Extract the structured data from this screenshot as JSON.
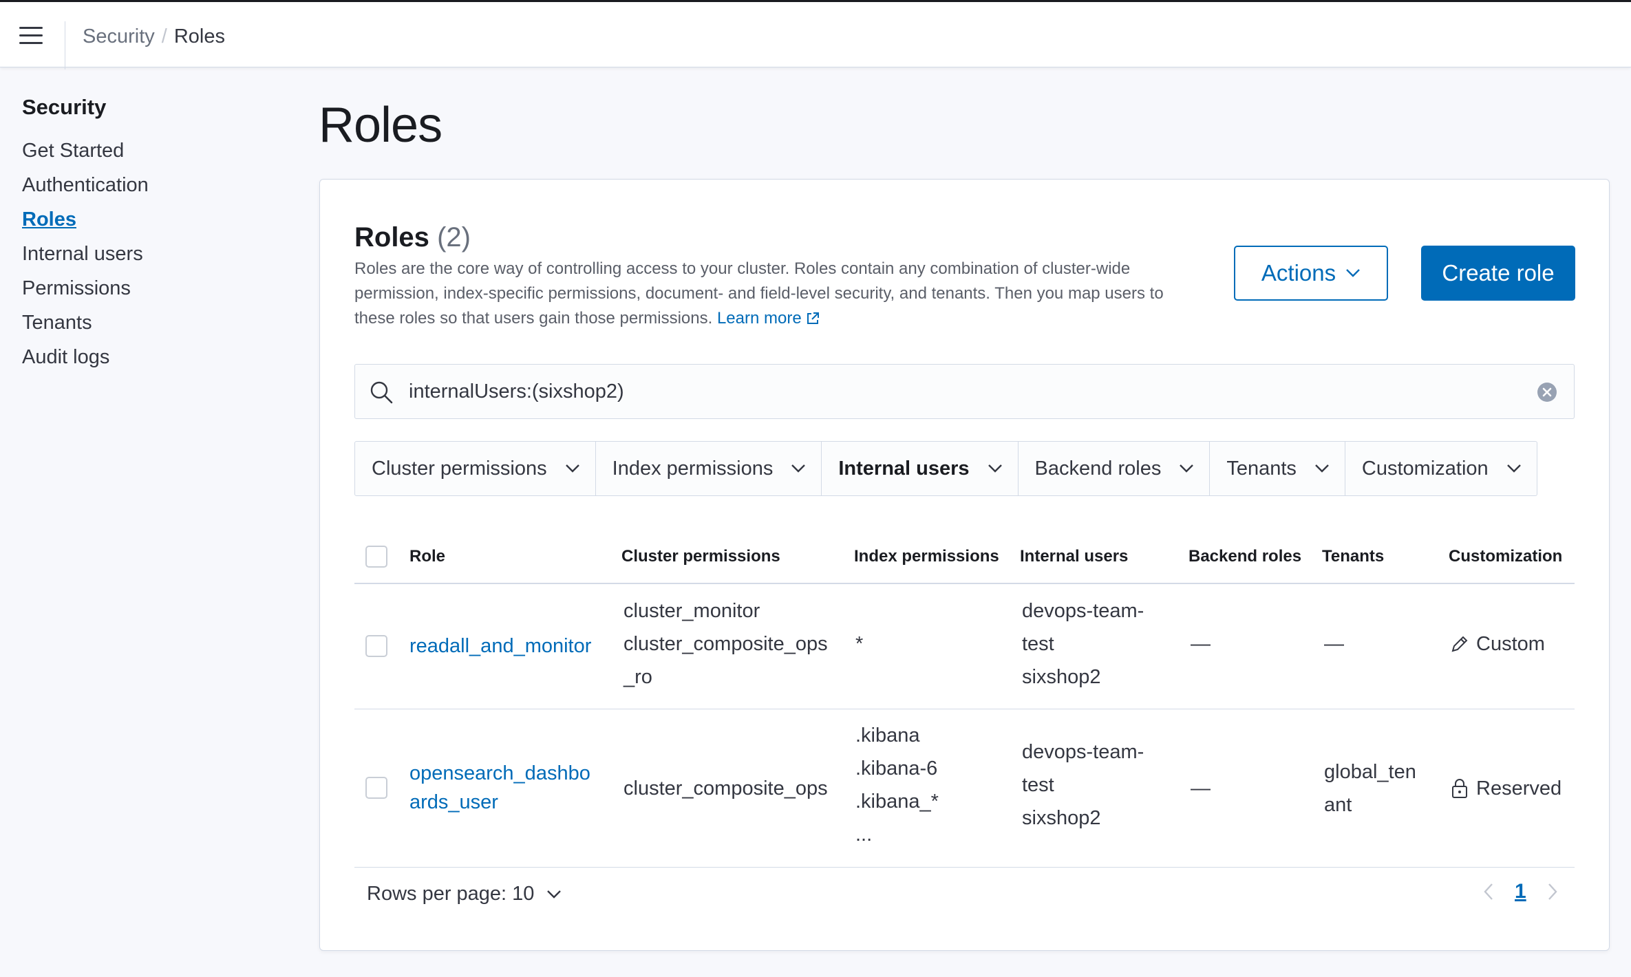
{
  "header": {
    "breadcrumbs": [
      "Security",
      "Roles"
    ]
  },
  "sidebar": {
    "title": "Security",
    "items": [
      {
        "label": "Get Started"
      },
      {
        "label": "Authentication"
      },
      {
        "label": "Roles",
        "active": true
      },
      {
        "label": "Internal users"
      },
      {
        "label": "Permissions"
      },
      {
        "label": "Tenants"
      },
      {
        "label": "Audit logs"
      }
    ]
  },
  "page": {
    "title": "Roles"
  },
  "panel": {
    "title": "Roles",
    "count": "(2)",
    "description": "Roles are the core way of controlling access to your cluster. Roles contain any combination of cluster-wide permission, index-specific permissions, document- and field-level security, and tenants. Then you map users to these roles so that users gain those permissions.",
    "learn_more": "Learn more",
    "actions_label": "Actions",
    "create_label": "Create role"
  },
  "search": {
    "value": "internalUsers:(sixshop2)"
  },
  "filters": [
    {
      "label": "Cluster permissions"
    },
    {
      "label": "Index permissions"
    },
    {
      "label": "Internal users",
      "active": true
    },
    {
      "label": "Backend roles"
    },
    {
      "label": "Tenants"
    },
    {
      "label": "Customization"
    }
  ],
  "table": {
    "columns": [
      "Role",
      "Cluster permissions",
      "Index permissions",
      "Internal users",
      "Backend roles",
      "Tenants",
      "Customization"
    ],
    "rows": [
      {
        "role": "readall_and_monitor",
        "cluster_permissions": [
          "cluster_monitor",
          "cluster_composite_ops",
          "_ro"
        ],
        "index_permissions": [
          "*"
        ],
        "internal_users": [
          "devops-team-",
          "test",
          "sixshop2"
        ],
        "backend_roles": "—",
        "tenants": "—",
        "customization": "Custom"
      },
      {
        "role_lines": [
          "opensearch_dashbo",
          "ards_user"
        ],
        "cluster_permissions": [
          "cluster_composite_ops"
        ],
        "index_permissions": [
          ".kibana",
          ".kibana-6",
          ".kibana_*",
          "..."
        ],
        "internal_users": [
          "devops-team-",
          "test",
          "sixshop2"
        ],
        "backend_roles": "—",
        "tenants_lines": [
          "global_ten",
          "ant"
        ],
        "customization": "Reserved"
      }
    ]
  },
  "pagination": {
    "rows_per_page": "Rows per page: 10",
    "current_page": "1"
  },
  "colors": {
    "primary": "#006bb8",
    "text": "#343741",
    "border": "#d3dae6",
    "background": "#f7f8fc"
  }
}
